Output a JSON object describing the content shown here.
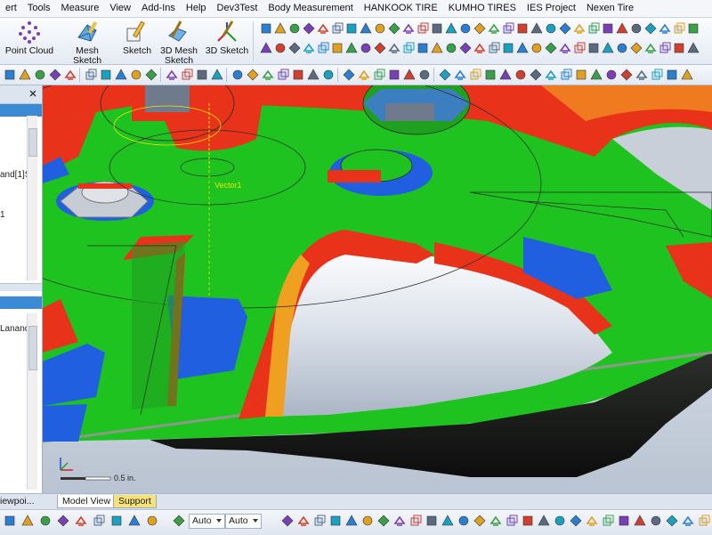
{
  "menu": [
    "ert",
    "Tools",
    "Measure",
    "View",
    "Add-Ins",
    "Help",
    "Dev3Test",
    "Body Measurement",
    "HANKOOK TIRE",
    "KUMHO TIRES",
    "IES Project",
    "Nexen Tire"
  ],
  "ribbon": {
    "buttons": [
      {
        "label_lines": [
          "Point Cloud"
        ],
        "icon": "point-cloud-icon"
      },
      {
        "label_lines": [
          "Mesh Sketch"
        ],
        "icon": "mesh-sketch-icon"
      },
      {
        "label_lines": [
          "Sketch"
        ],
        "icon": "sketch-icon"
      },
      {
        "label_lines": [
          "3D Mesh",
          "Sketch"
        ],
        "icon": "3d-mesh-sketch-icon"
      },
      {
        "label_lines": [
          "3D Sketch"
        ],
        "icon": "3d-sketch-icon"
      }
    ]
  },
  "left_panel": {
    "top_text_1": "and[1]S",
    "top_text_2": "1",
    "bottom_text": "Lanand"
  },
  "viewport": {
    "vector_label": "Vector1",
    "scale_label": "0.5 in."
  },
  "tabs": {
    "side_label": "iewpoi...",
    "model_view": "Model View",
    "support": "Support"
  },
  "status": {
    "select1": "Auto",
    "select2": "Auto"
  },
  "colors": {
    "mesh_green": "#1fc31f",
    "mesh_red": "#e8321a",
    "mesh_blue": "#1f5fe0",
    "selection_blue": "#3a8ad6",
    "vector_yellow": "#e6e600"
  }
}
